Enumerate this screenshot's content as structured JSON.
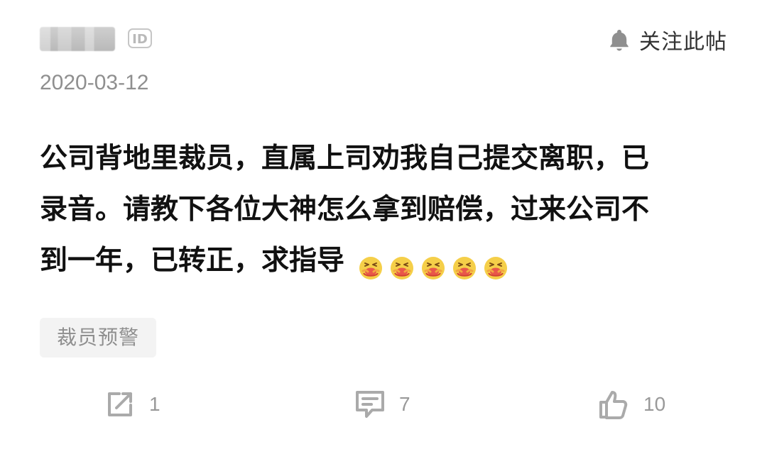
{
  "header": {
    "id_badge": "ID",
    "follow_label": "关注此帖"
  },
  "post": {
    "date": "2020-03-12",
    "lines": [
      "公司背地里裁员，直属上司劝我自己提交离职，已",
      "录音。请教下各位大神怎么拿到赔偿，过来公司不",
      "到一年，已转正，求指导"
    ],
    "emojis": [
      "nauseated-face",
      "nauseated-face",
      "nauseated-face",
      "nauseated-face",
      "nauseated-face"
    ],
    "tag": "裁员预警"
  },
  "actions": {
    "share_count": "1",
    "comment_count": "7",
    "like_count": "10"
  },
  "icons": {
    "bell": "bell-icon",
    "share": "share-icon",
    "comment": "comment-icon",
    "like": "thumbs-up-icon"
  },
  "colors": {
    "text_primary": "#111111",
    "text_secondary": "#8f8f8f",
    "icon_gray": "#aaaaaa",
    "tag_bg": "#f3f3f3"
  }
}
